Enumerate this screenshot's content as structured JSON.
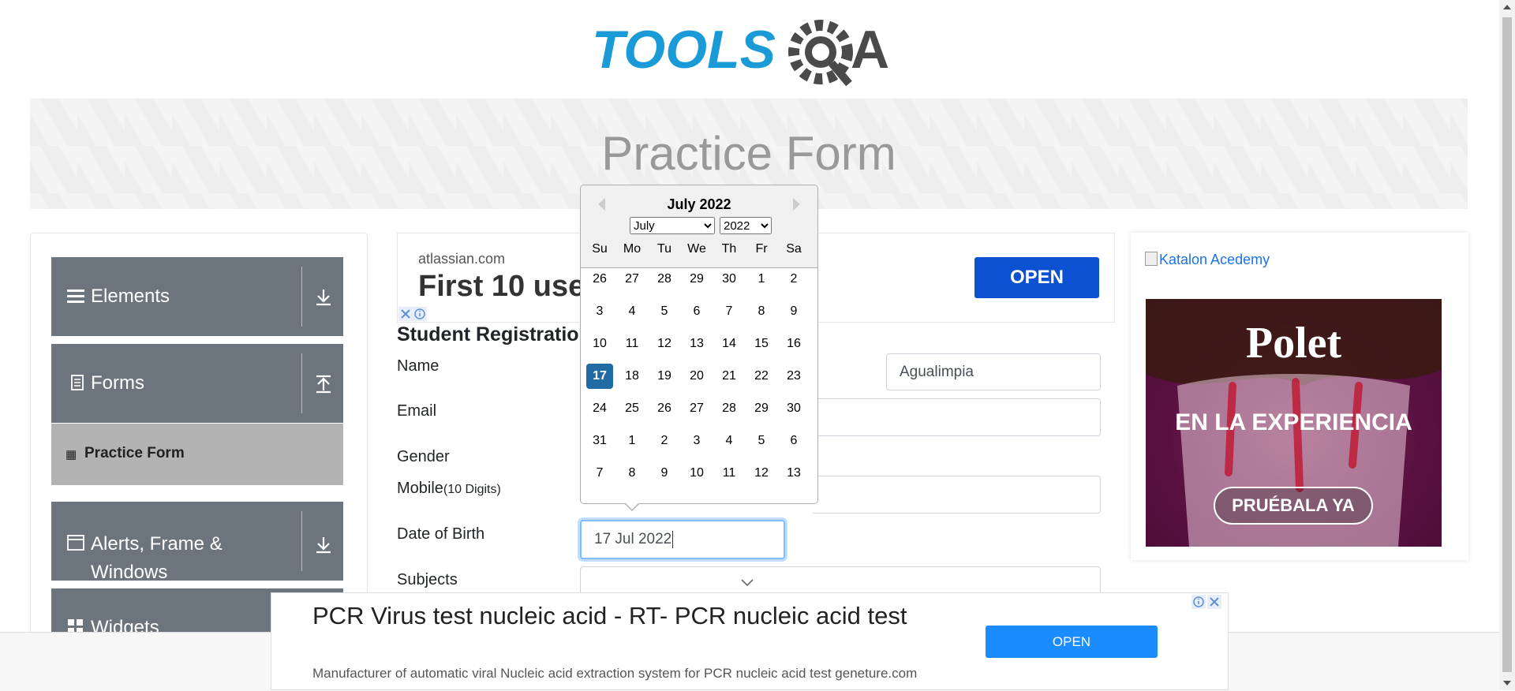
{
  "logo": {
    "text_left": "TOOLS",
    "text_right": "A"
  },
  "banner": {
    "title": "Practice Form"
  },
  "sidebar": {
    "groups": [
      {
        "label": "Elements",
        "icon": "hamburger-icon"
      },
      {
        "label": "Forms",
        "icon": "document-icon"
      },
      {
        "label": "Alerts, Frame & Windows",
        "icon": "window-icon"
      },
      {
        "label": "Widgets",
        "icon": "widgets-icon"
      }
    ],
    "active_item": "Practice Form"
  },
  "ad_top": {
    "domain": "atlassian.com",
    "headline": "First 10 users free",
    "open_label": "OPEN"
  },
  "form": {
    "title": "Student Registration Form",
    "labels": {
      "name": "Name",
      "email": "Email",
      "gender": "Gender",
      "mobile": "Mobile",
      "mobile_hint": "(10 Digits)",
      "dob": "Date of Birth",
      "subjects": "Subjects"
    },
    "last_name_value": "Agualimpia",
    "dob_value": "17 Jul 2022"
  },
  "calendar": {
    "title": "July 2022",
    "month_options": [
      "July"
    ],
    "year_options": [
      "2022"
    ],
    "day_names": [
      "Su",
      "Mo",
      "Tu",
      "We",
      "Th",
      "Fr",
      "Sa"
    ],
    "weeks": [
      [
        "26",
        "27",
        "28",
        "29",
        "30",
        "1",
        "2"
      ],
      [
        "3",
        "4",
        "5",
        "6",
        "7",
        "8",
        "9"
      ],
      [
        "10",
        "11",
        "12",
        "13",
        "14",
        "15",
        "16"
      ],
      [
        "17",
        "18",
        "19",
        "20",
        "21",
        "22",
        "23"
      ],
      [
        "24",
        "25",
        "26",
        "27",
        "28",
        "29",
        "30"
      ],
      [
        "31",
        "1",
        "2",
        "3",
        "4",
        "5",
        "6"
      ],
      [
        "7",
        "8",
        "9",
        "10",
        "11",
        "12",
        "13"
      ]
    ],
    "selected_day": "17",
    "selected_color": "#216ba5"
  },
  "ad_right": {
    "link_text": "Katalon Acedemy",
    "brand": "Polet",
    "slogan": "EN LA EXPERIENCIA",
    "cta": "PRUÉBALA YA"
  },
  "ad_bottom": {
    "headline": "PCR Virus test nucleic acid - RT- PCR nucleic acid test",
    "subtext": "Manufacturer of automatic viral Nucleic acid extraction system for PCR nucleic acid test geneture.com",
    "open_label": "OPEN"
  }
}
